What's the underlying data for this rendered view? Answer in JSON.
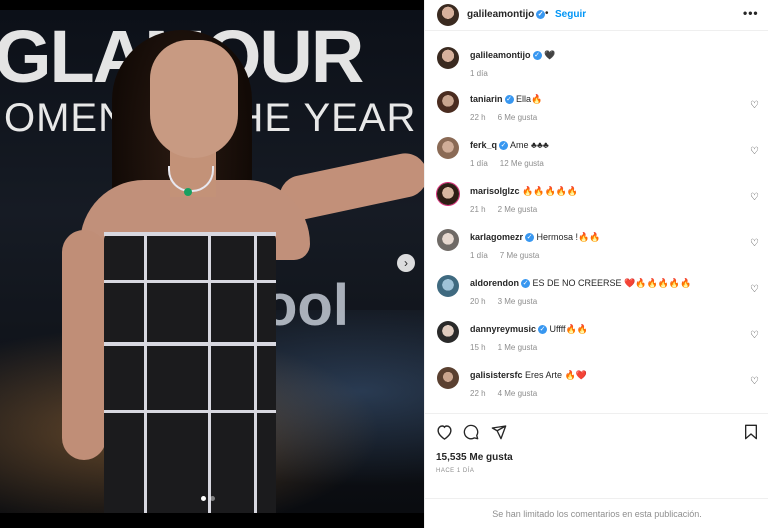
{
  "post": {
    "header": {
      "username": "galileamontijo",
      "separator": "•",
      "follow_label": "Seguir",
      "more_label": "•••"
    },
    "caption": {
      "username": "galileamontijo",
      "text": "🖤",
      "time": "1 día"
    },
    "media": {
      "background_text_1": "GLAMOUR",
      "background_text_2": "OMEN OF THE YEAR",
      "background_logo": "ool",
      "carousel_slides": 2,
      "active_slide": 1
    },
    "comments": [
      {
        "username": "taniarin",
        "verified": true,
        "text": "Ella🔥",
        "time": "22 h",
        "likes": "6 Me gusta"
      },
      {
        "username": "ferk_q",
        "verified": true,
        "text": "Ame ♣♣♣",
        "time": "1 día",
        "likes": "12 Me gusta"
      },
      {
        "username": "marisolglzc",
        "verified": false,
        "text": "🔥🔥🔥🔥🔥",
        "time": "21 h",
        "likes": "2 Me gusta"
      },
      {
        "username": "karlagomezr",
        "verified": true,
        "text": "Hermosa !🔥🔥",
        "time": "1 día",
        "likes": "7 Me gusta"
      },
      {
        "username": "aldorendon",
        "verified": true,
        "text": "ES DE NO CREERSE ❤️🔥🔥🔥🔥🔥",
        "time": "20 h",
        "likes": "3 Me gusta"
      },
      {
        "username": "dannyreymusic",
        "verified": true,
        "text": "Uffff🔥🔥",
        "time": "15 h",
        "likes": "1 Me gusta"
      },
      {
        "username": "galisistersfc",
        "verified": false,
        "text": "Eres Arte 🔥❤️",
        "time": "22 h",
        "likes": "4 Me gusta"
      }
    ],
    "likes_count": "15,535 Me gusta",
    "date_label": "HACE 1 DÍA",
    "comments_limited": "Se han limitado los comentarios en esta publicación.",
    "colors": {
      "accent": "#0095f6",
      "verified": "#3897f0",
      "muted": "#8e8e8e",
      "text": "#262626"
    },
    "icons": [
      "heart-icon",
      "comment-icon",
      "share-icon",
      "bookmark-icon",
      "chevron-right-icon",
      "verified-icon",
      "more-icon"
    ]
  }
}
